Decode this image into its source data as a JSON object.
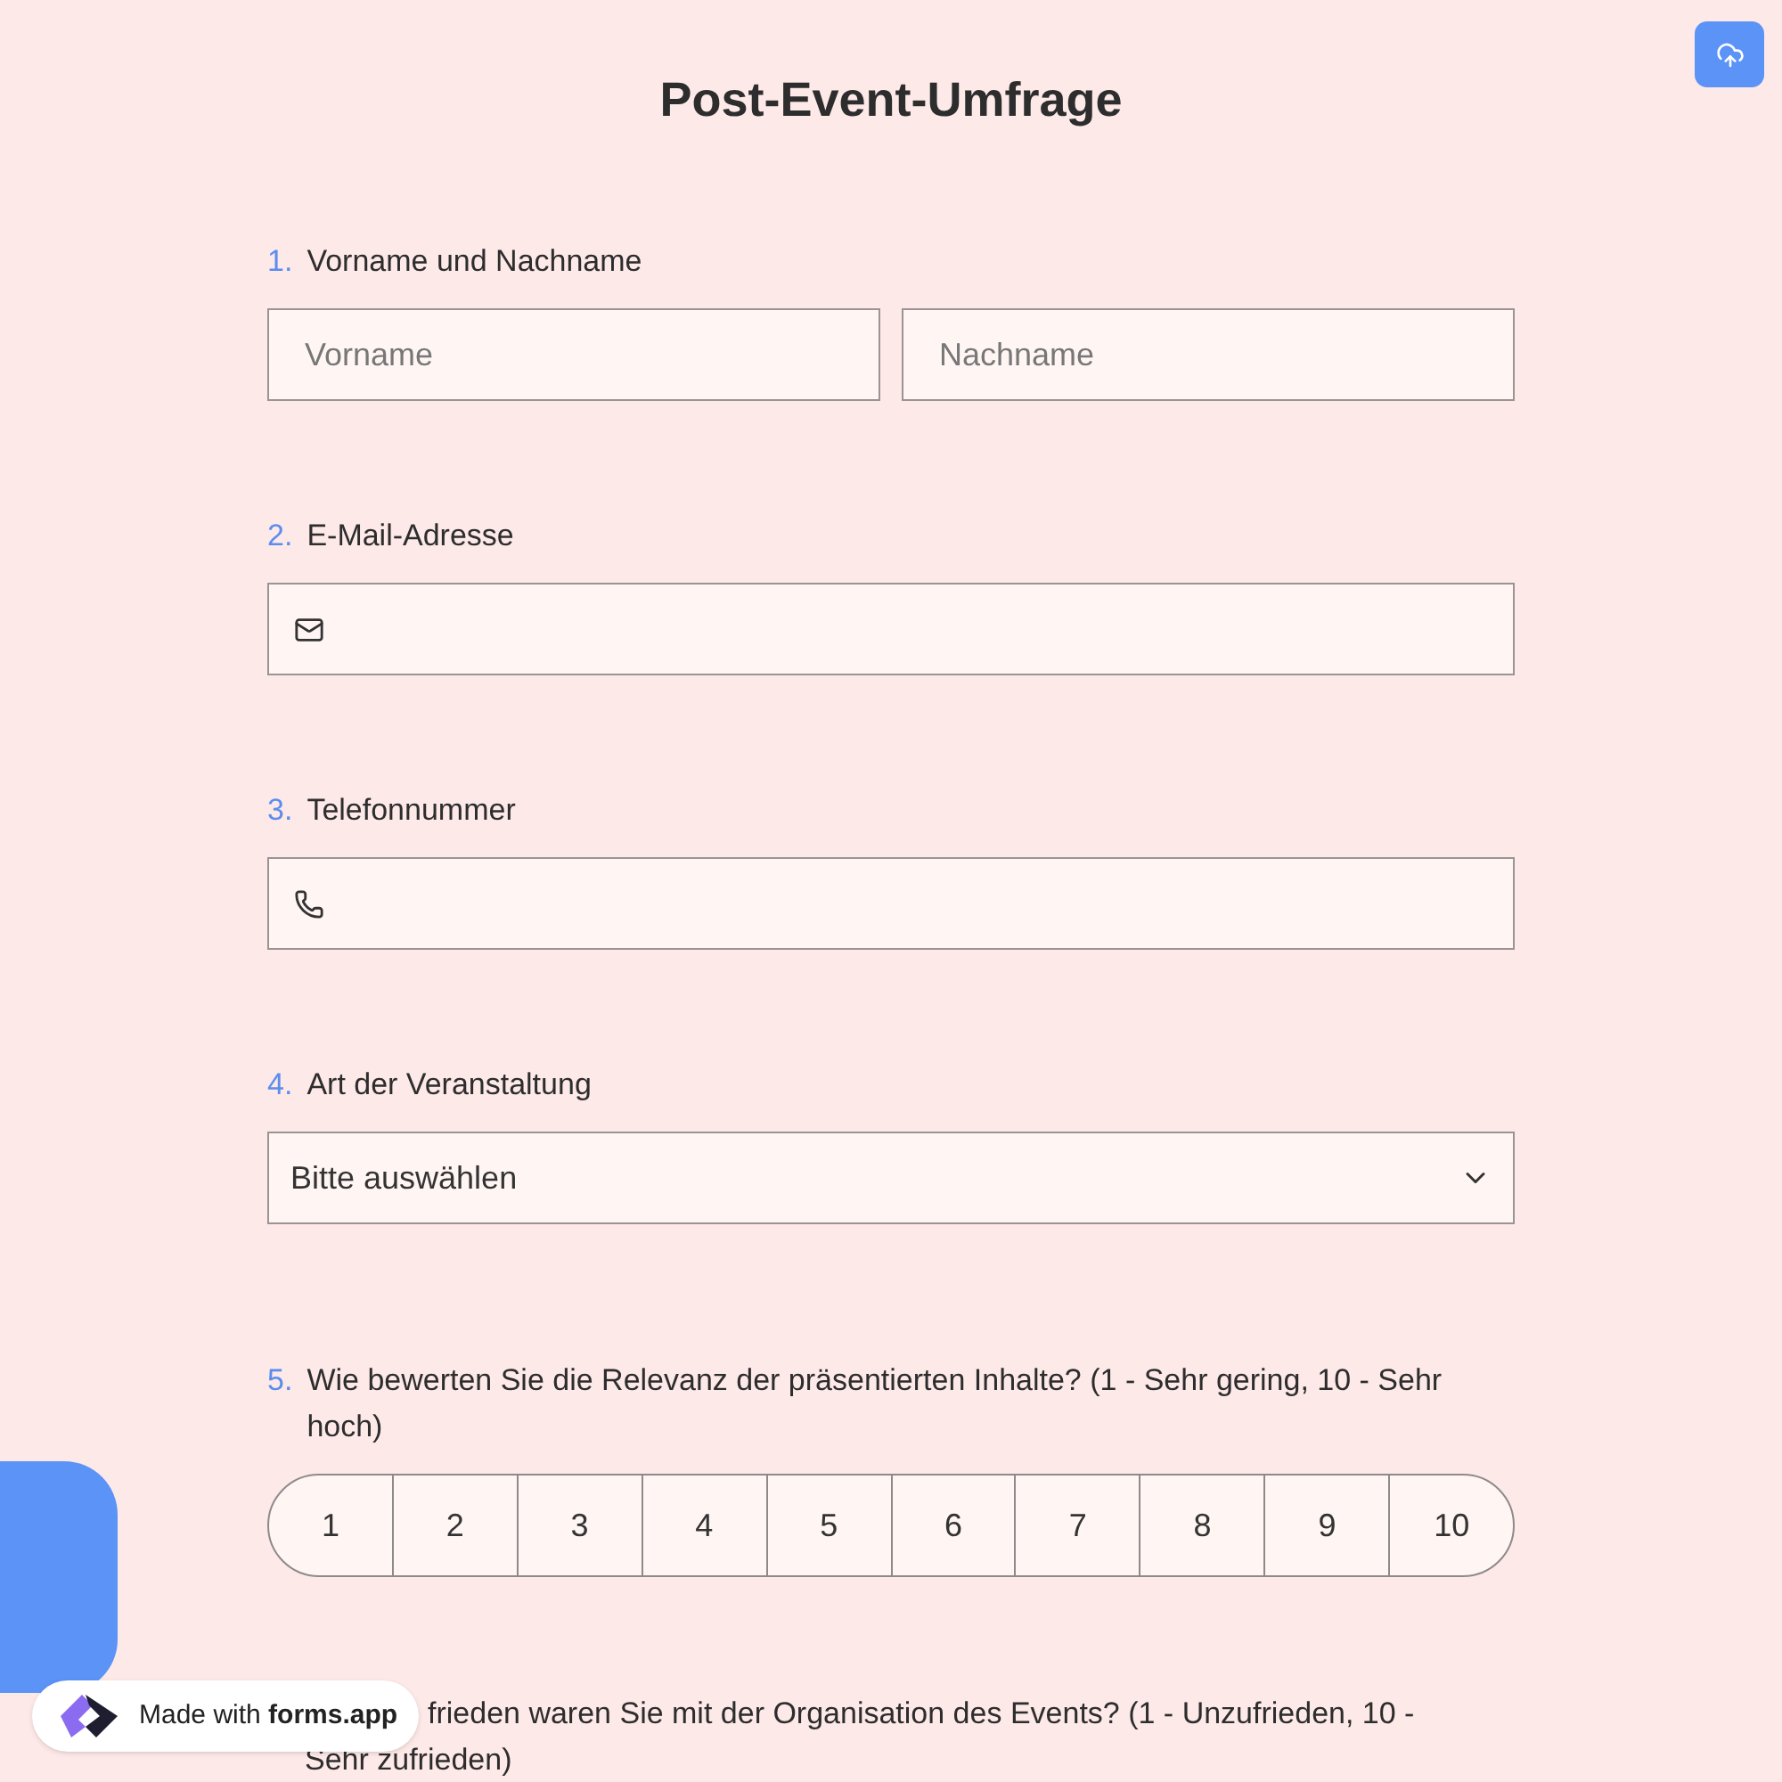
{
  "title": "Post-Event-Umfrage",
  "questions": [
    {
      "kind": "name",
      "number": "1.",
      "label": "Vorname und Nachname",
      "placeholders": [
        "Vorname",
        "Nachname"
      ]
    },
    {
      "kind": "email",
      "number": "2.",
      "label": "E-Mail-Adresse"
    },
    {
      "kind": "phone",
      "number": "3.",
      "label": "Telefonnummer"
    },
    {
      "kind": "select",
      "number": "4.",
      "label": "Art der Veranstaltung",
      "value": "Bitte auswählen"
    },
    {
      "kind": "rating",
      "number": "5.",
      "label": "Wie bewerten Sie die Relevanz der präsentierten Inhalte? (1 - Sehr gering, 10 - Sehr hoch)",
      "options": [
        "1",
        "2",
        "3",
        "4",
        "5",
        "6",
        "7",
        "8",
        "9",
        "10"
      ]
    },
    {
      "kind": "partial",
      "lines": [
        "frieden waren Sie mit der Organisation des Events? (1 - Unzufrieden, 10 -",
        "Sehr zufrieden)"
      ]
    }
  ],
  "badge": {
    "prefix": "Made with",
    "brand": "forms.app"
  }
}
